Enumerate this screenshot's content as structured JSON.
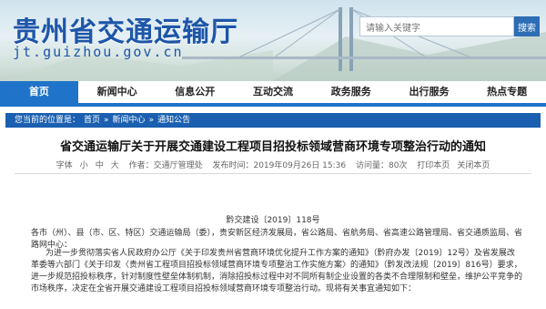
{
  "site": {
    "title": "贵州省交通运输厅",
    "url": "jt.guizhou.gov.cn"
  },
  "search": {
    "placeholder": "请输入关键字",
    "button_label": "搜索"
  },
  "nav": {
    "items": [
      {
        "label": "首页"
      },
      {
        "label": "新闻中心"
      },
      {
        "label": "信息公开"
      },
      {
        "label": "互动交流"
      },
      {
        "label": "政务服务"
      },
      {
        "label": "出行服务"
      },
      {
        "label": "热点专题"
      }
    ]
  },
  "breadcrumb": {
    "prefix": "您当前的位置是：",
    "items": [
      "首页",
      "新闻中心",
      "通知公告"
    ],
    "separator": "»"
  },
  "article": {
    "title": "省交通运输厅关于开展交通建设工程项目招投标领域营商环境专项整治行动的通知",
    "font_size_label": "字体",
    "font_sizes": [
      "小",
      "中",
      "大"
    ],
    "source": "作者：交通厅管理处",
    "published": "发布时间：2019年09月26日 15:36",
    "views": "访问量：80次",
    "print_label": "打印本页",
    "close_label": "关闭本页",
    "doc_number": "黔交建设〔2019〕118号",
    "p1": "各市（州）、县（市、区、特区）交通运输局（委），贵安新区经济发展局，省公路局、省航务局、省高速公路管理局、省交通质监局、省路网中心：",
    "p2": "为进一步贯彻落实省人民政府办公厅《关于印发贵州省营商环境优化提升工作方案的通知》（黔府办发〔2019〕12号）及省发展改革委等六部门《关于印发〈贵州省工程项目招投标领域营商环境专项整治工作实施方案〉的通知》（黔发改法规〔2019〕816号）要求，进一步规范招投标秩序，针对制度性壁垒体制机制，消除招投标过程中对不同所有制企业设置的各类不合理限制和壁垒，维护公平竞争的市场秩序，决定在全省开展交通建设工程项目招投标领域营商环境专项整治行动。现将有关事宜通知如下："
  },
  "colors": {
    "brand": "#1d56a8",
    "nav_active": "#1f73c9",
    "breadcrumb_bg": "#1a5fb0"
  }
}
